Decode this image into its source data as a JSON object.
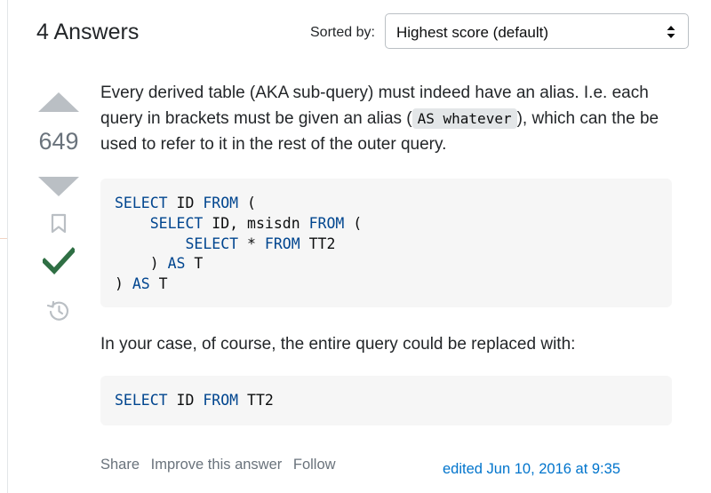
{
  "header": {
    "answers_count": "4 Answers",
    "sort_label": "Sorted by:",
    "sort_value": "Highest score (default)"
  },
  "vote": {
    "score": "649"
  },
  "answer": {
    "para1_before": "Every derived table (AKA sub-query) must indeed have an alias. I.e. each query in brackets must be given an alias (",
    "inline_code": "AS whatever",
    "para1_after": "), which can the be used to refer to it in the rest of the outer query.",
    "code1_lines": [
      {
        "indent": "",
        "parts": [
          {
            "kw": true,
            "t": "SELECT"
          },
          {
            "kw": false,
            "t": " ID "
          },
          {
            "kw": true,
            "t": "FROM"
          },
          {
            "kw": false,
            "t": " ("
          }
        ]
      },
      {
        "indent": "    ",
        "parts": [
          {
            "kw": true,
            "t": "SELECT"
          },
          {
            "kw": false,
            "t": " ID, msisdn "
          },
          {
            "kw": true,
            "t": "FROM"
          },
          {
            "kw": false,
            "t": " ("
          }
        ]
      },
      {
        "indent": "        ",
        "parts": [
          {
            "kw": true,
            "t": "SELECT"
          },
          {
            "kw": false,
            "t": " * "
          },
          {
            "kw": true,
            "t": "FROM"
          },
          {
            "kw": false,
            "t": " TT2"
          }
        ]
      },
      {
        "indent": "    ",
        "parts": [
          {
            "kw": false,
            "t": ") "
          },
          {
            "kw": true,
            "t": "AS"
          },
          {
            "kw": false,
            "t": " T"
          }
        ]
      },
      {
        "indent": "",
        "parts": [
          {
            "kw": false,
            "t": ") "
          },
          {
            "kw": true,
            "t": "AS"
          },
          {
            "kw": false,
            "t": " T"
          }
        ]
      }
    ],
    "para2": "In your case, of course, the entire query could be replaced with:",
    "code2_lines": [
      {
        "indent": "",
        "parts": [
          {
            "kw": true,
            "t": "SELECT"
          },
          {
            "kw": false,
            "t": " ID "
          },
          {
            "kw": true,
            "t": "FROM"
          },
          {
            "kw": false,
            "t": " TT2"
          }
        ]
      }
    ]
  },
  "menu": {
    "share": "Share",
    "improve": "Improve this answer",
    "follow": "Follow"
  },
  "edited": "edited Jun 10, 2016 at 9:35",
  "icons": {
    "vote_up": "triangle-up-icon",
    "vote_down": "triangle-down-icon",
    "bookmark": "bookmark-icon",
    "accepted": "checkmark-icon",
    "history": "history-icon",
    "sort": "sort-arrows-icon"
  },
  "colors": {
    "vote_arrow": "#babfc4",
    "accepted": "#2f6f44",
    "keyword": "#00458f",
    "link": "#0074cc",
    "muted": "#6a737c"
  }
}
